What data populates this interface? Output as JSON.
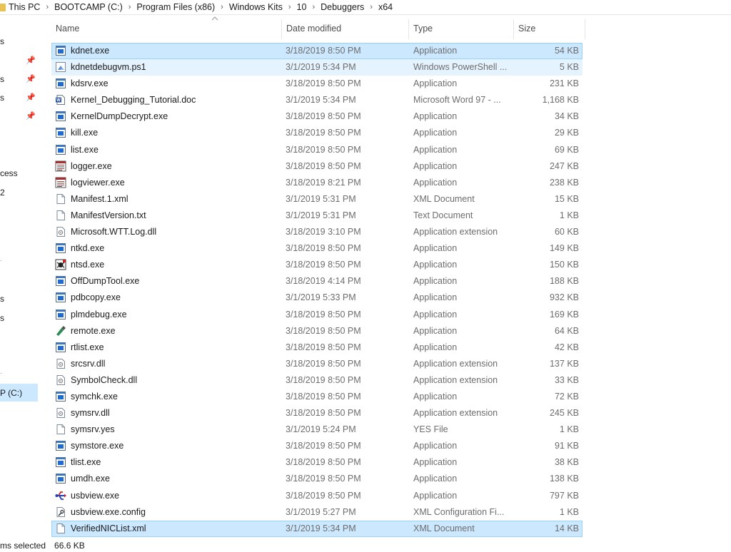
{
  "breadcrumb": [
    "This PC",
    "BOOTCAMP (C:)",
    "Program Files (x86)",
    "Windows Kits",
    "10",
    "Debuggers",
    "x64"
  ],
  "nav_pane": {
    "items": [
      {
        "label": "s"
      },
      {
        "label": "s"
      },
      {
        "label": "s"
      },
      {
        "label": "cess"
      },
      {
        "label": "2"
      },
      {
        "label": "s"
      },
      {
        "label": "s"
      },
      {
        "label": "s"
      },
      {
        "label": "P (C:)"
      }
    ]
  },
  "columns": {
    "name": "Name",
    "date": "Date modified",
    "type": "Type",
    "size": "Size"
  },
  "files": [
    {
      "name": "kdnet.exe",
      "date": "3/18/2019 8:50 PM",
      "type": "Application",
      "size": "54 KB",
      "icon": "application-icon",
      "state": "dark"
    },
    {
      "name": "kdnetdebugvm.ps1",
      "date": "3/1/2019 5:34 PM",
      "type": "Windows PowerShell ...",
      "size": "5 KB",
      "icon": "powershell-script-icon",
      "state": "light"
    },
    {
      "name": "kdsrv.exe",
      "date": "3/18/2019 8:50 PM",
      "type": "Application",
      "size": "231 KB",
      "icon": "application-icon",
      "state": ""
    },
    {
      "name": "Kernel_Debugging_Tutorial.doc",
      "date": "3/1/2019 5:34 PM",
      "type": "Microsoft Word 97 - ...",
      "size": "1,168 KB",
      "icon": "word-document-icon",
      "state": ""
    },
    {
      "name": "KernelDumpDecrypt.exe",
      "date": "3/18/2019 8:50 PM",
      "type": "Application",
      "size": "34 KB",
      "icon": "application-icon",
      "state": ""
    },
    {
      "name": "kill.exe",
      "date": "3/18/2019 8:50 PM",
      "type": "Application",
      "size": "29 KB",
      "icon": "application-icon",
      "state": ""
    },
    {
      "name": "list.exe",
      "date": "3/18/2019 8:50 PM",
      "type": "Application",
      "size": "69 KB",
      "icon": "application-icon",
      "state": ""
    },
    {
      "name": "logger.exe",
      "date": "3/18/2019 8:50 PM",
      "type": "Application",
      "size": "247 KB",
      "icon": "logger-icon",
      "state": ""
    },
    {
      "name": "logviewer.exe",
      "date": "3/18/2019 8:21 PM",
      "type": "Application",
      "size": "238 KB",
      "icon": "logger-icon",
      "state": ""
    },
    {
      "name": "Manifest.1.xml",
      "date": "3/1/2019 5:31 PM",
      "type": "XML Document",
      "size": "15 KB",
      "icon": "blank-document-icon",
      "state": ""
    },
    {
      "name": "ManifestVersion.txt",
      "date": "3/1/2019 5:31 PM",
      "type": "Text Document",
      "size": "1 KB",
      "icon": "blank-document-icon",
      "state": ""
    },
    {
      "name": "Microsoft.WTT.Log.dll",
      "date": "3/18/2019 3:10 PM",
      "type": "Application extension",
      "size": "60 KB",
      "icon": "dll-icon",
      "state": ""
    },
    {
      "name": "ntkd.exe",
      "date": "3/18/2019 8:50 PM",
      "type": "Application",
      "size": "149 KB",
      "icon": "application-icon",
      "state": ""
    },
    {
      "name": "ntsd.exe",
      "date": "3/18/2019 8:50 PM",
      "type": "Application",
      "size": "150 KB",
      "icon": "ntsd-icon",
      "state": ""
    },
    {
      "name": "OffDumpTool.exe",
      "date": "3/18/2019 4:14 PM",
      "type": "Application",
      "size": "188 KB",
      "icon": "application-icon",
      "state": ""
    },
    {
      "name": "pdbcopy.exe",
      "date": "3/1/2019 5:33 PM",
      "type": "Application",
      "size": "932 KB",
      "icon": "application-icon",
      "state": ""
    },
    {
      "name": "plmdebug.exe",
      "date": "3/18/2019 8:50 PM",
      "type": "Application",
      "size": "169 KB",
      "icon": "application-icon",
      "state": ""
    },
    {
      "name": "remote.exe",
      "date": "3/18/2019 8:50 PM",
      "type": "Application",
      "size": "64 KB",
      "icon": "remote-icon",
      "state": ""
    },
    {
      "name": "rtlist.exe",
      "date": "3/18/2019 8:50 PM",
      "type": "Application",
      "size": "42 KB",
      "icon": "application-icon",
      "state": ""
    },
    {
      "name": "srcsrv.dll",
      "date": "3/18/2019 8:50 PM",
      "type": "Application extension",
      "size": "137 KB",
      "icon": "dll-icon",
      "state": ""
    },
    {
      "name": "SymbolCheck.dll",
      "date": "3/18/2019 8:50 PM",
      "type": "Application extension",
      "size": "33 KB",
      "icon": "dll-icon",
      "state": ""
    },
    {
      "name": "symchk.exe",
      "date": "3/18/2019 8:50 PM",
      "type": "Application",
      "size": "72 KB",
      "icon": "application-icon",
      "state": ""
    },
    {
      "name": "symsrv.dll",
      "date": "3/18/2019 8:50 PM",
      "type": "Application extension",
      "size": "245 KB",
      "icon": "dll-icon",
      "state": ""
    },
    {
      "name": "symsrv.yes",
      "date": "3/1/2019 5:24 PM",
      "type": "YES File",
      "size": "1 KB",
      "icon": "blank-document-icon",
      "state": ""
    },
    {
      "name": "symstore.exe",
      "date": "3/18/2019 8:50 PM",
      "type": "Application",
      "size": "91 KB",
      "icon": "application-icon",
      "state": ""
    },
    {
      "name": "tlist.exe",
      "date": "3/18/2019 8:50 PM",
      "type": "Application",
      "size": "38 KB",
      "icon": "application-icon",
      "state": ""
    },
    {
      "name": "umdh.exe",
      "date": "3/18/2019 8:50 PM",
      "type": "Application",
      "size": "138 KB",
      "icon": "application-icon",
      "state": ""
    },
    {
      "name": "usbview.exe",
      "date": "3/18/2019 8:50 PM",
      "type": "Application",
      "size": "797 KB",
      "icon": "usbview-icon",
      "state": ""
    },
    {
      "name": "usbview.exe.config",
      "date": "3/1/2019 5:27 PM",
      "type": "XML Configuration Fi...",
      "size": "1 KB",
      "icon": "config-file-icon",
      "state": ""
    },
    {
      "name": "VerifiedNICList.xml",
      "date": "3/1/2019 5:34 PM",
      "type": "XML Document",
      "size": "14 KB",
      "icon": "blank-document-icon",
      "state": "dark"
    }
  ],
  "status_bar": {
    "selection": "ms selected",
    "size": "66.6 KB"
  },
  "colors": {
    "selected": "#cce8ff",
    "hover": "#e5f3ff",
    "secondary_text": "#6d6d6d"
  }
}
